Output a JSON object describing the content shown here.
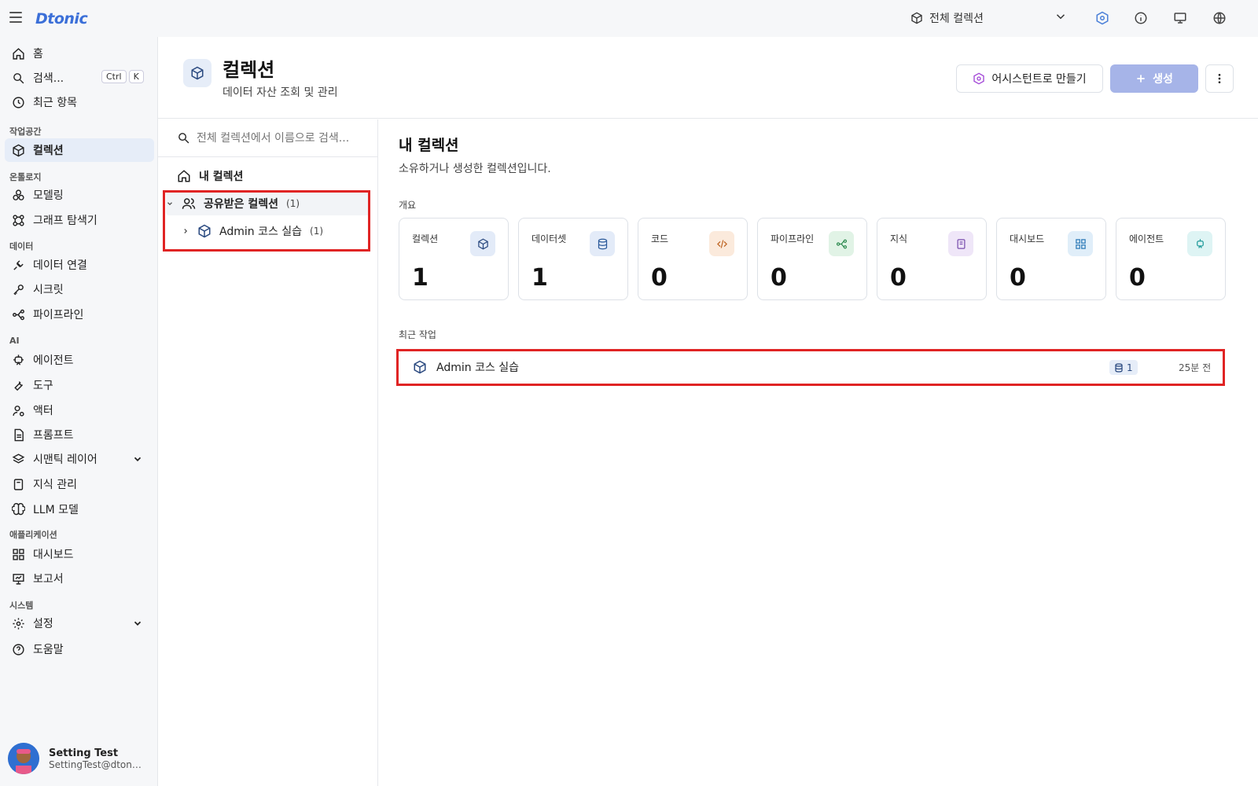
{
  "topbar": {
    "logo": "Dtonic",
    "collection_selector": "전체 컬렉션"
  },
  "sidebar": {
    "home": "홈",
    "search": "검색...",
    "search_shortcut": [
      "Ctrl",
      "K"
    ],
    "recent": "최근 항목",
    "sections": {
      "workspace": "작업공간",
      "ontology": "온톨로지",
      "data": "데이터",
      "ai": "AI",
      "application": "애플리케이션",
      "system": "시스템"
    },
    "items": {
      "collection": "컬렉션",
      "modeling": "모델링",
      "graph_explorer": "그래프 탐색기",
      "data_connection": "데이터 연결",
      "secret": "시크릿",
      "pipeline": "파이프라인",
      "agent": "에이전트",
      "tool": "도구",
      "actor": "액터",
      "prompt": "프롬프트",
      "semantic_layer": "시맨틱 레이어",
      "knowledge": "지식 관리",
      "llm_model": "LLM 모델",
      "dashboard": "대시보드",
      "report": "보고서",
      "settings": "설정",
      "help": "도움말"
    },
    "user": {
      "name": "Setting Test",
      "email": "SettingTest@dtonic.io"
    }
  },
  "header": {
    "title": "컬렉션",
    "subtitle": "데이터 자산 조회 및 관리",
    "assistant_button": "어시스턴트로 만들기",
    "create_button": "생성"
  },
  "tree": {
    "search_placeholder": "전체 컬렉션에서 이름으로 검색...",
    "my_collections": "내 컬렉션",
    "shared": {
      "label": "공유받은 컬렉션",
      "count": "(1)"
    },
    "child": {
      "label": "Admin 코스 실습",
      "count": "(1)"
    }
  },
  "content": {
    "title": "내 컬렉션",
    "subtitle": "소유하거나 생성한 컬렉션입니다.",
    "overview_label": "개요",
    "recent_label": "최근 작업",
    "stats": [
      {
        "label": "컬렉션",
        "value": "1",
        "icon": "cube-icon",
        "color": "#e3ebf8",
        "icon_color": "#2b4a80"
      },
      {
        "label": "데이터셋",
        "value": "1",
        "icon": "database-icon",
        "color": "#e3ebf8",
        "icon_color": "#2b5a9a"
      },
      {
        "label": "코드",
        "value": "0",
        "icon": "code-icon",
        "color": "#fbeadc",
        "icon_color": "#c0692a"
      },
      {
        "label": "파이프라인",
        "value": "0",
        "icon": "pipeline-icon",
        "color": "#e1f3e6",
        "icon_color": "#2e8a50"
      },
      {
        "label": "지식",
        "value": "0",
        "icon": "book-icon",
        "color": "#efe6f8",
        "icon_color": "#7a4fae"
      },
      {
        "label": "대시보드",
        "value": "0",
        "icon": "dashboard-icon",
        "color": "#e0eef9",
        "icon_color": "#2e7bb8"
      },
      {
        "label": "에이전트",
        "value": "0",
        "icon": "agent-icon",
        "color": "#def4f4",
        "icon_color": "#1f9a9a"
      }
    ],
    "recent": [
      {
        "name": "Admin 코스 실습",
        "badge": "1",
        "time": "25분 전"
      }
    ]
  }
}
